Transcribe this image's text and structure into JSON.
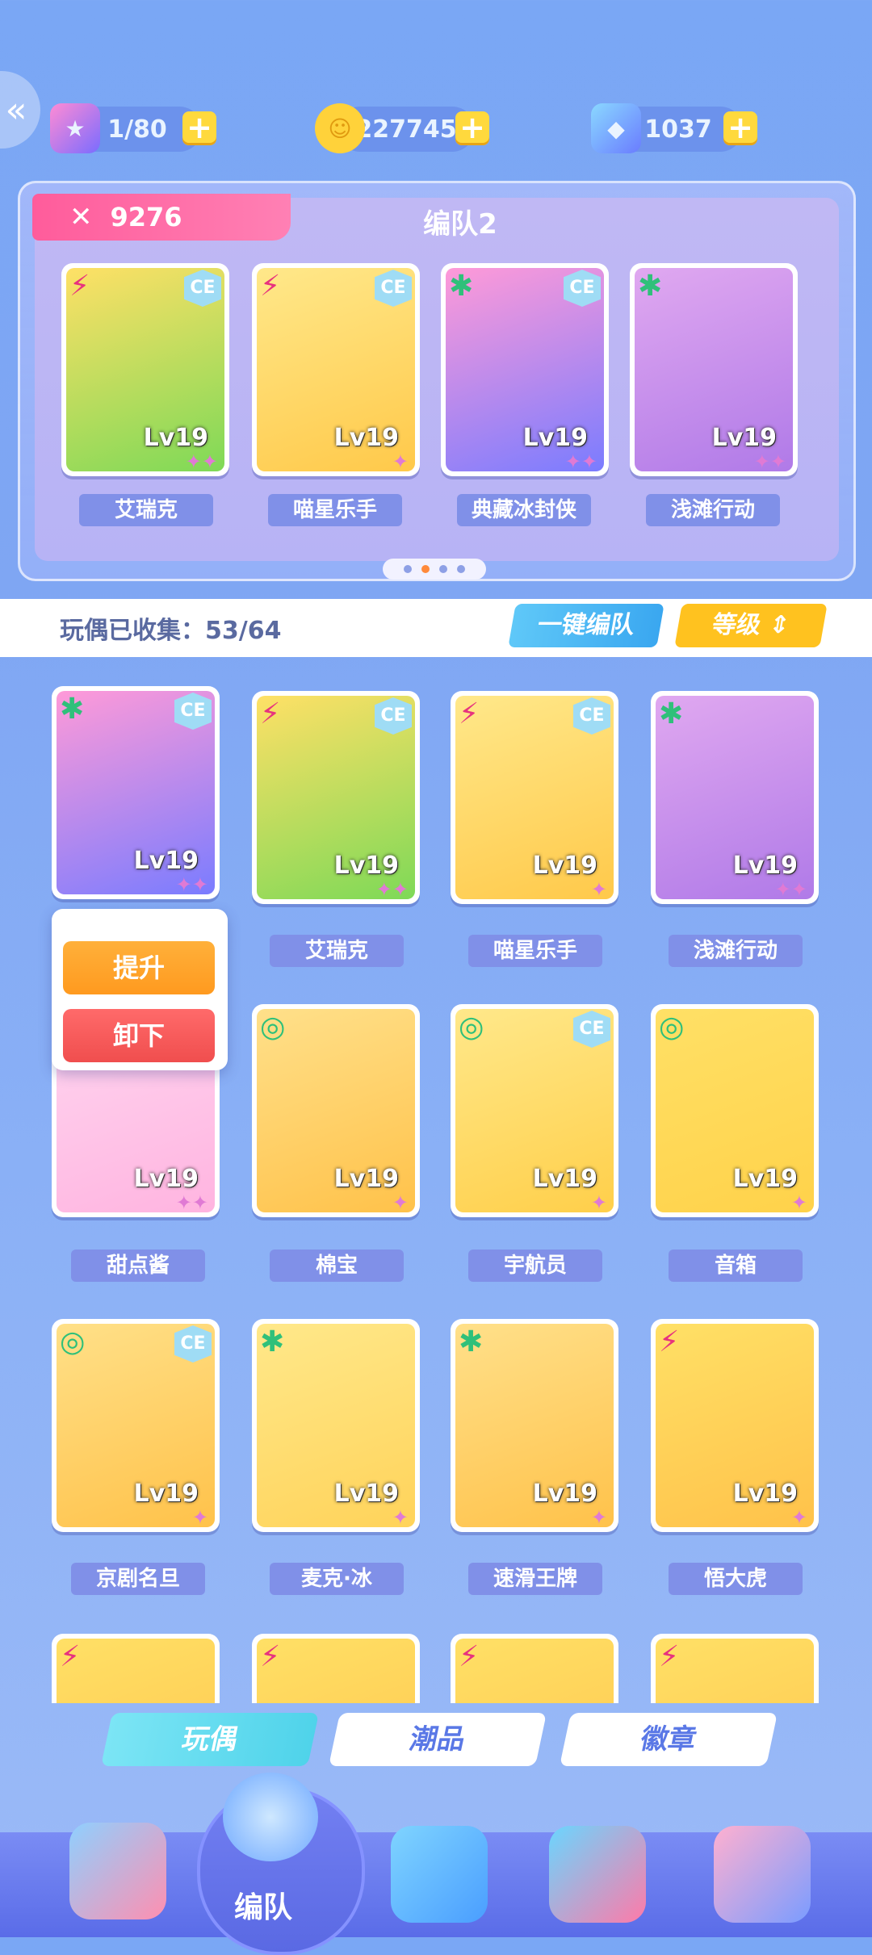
{
  "resources": [
    {
      "name": "energy",
      "icon": "ticket-icon",
      "value": "1/80"
    },
    {
      "name": "coins",
      "icon": "coin-icon",
      "value": "227745"
    },
    {
      "name": "gems",
      "icon": "crystal-icon",
      "value": "1037"
    }
  ],
  "team": {
    "power": "9276",
    "name": "编队2",
    "members": [
      {
        "name": "艾瑞克",
        "level": "Lv19",
        "element": "⚡",
        "ce": true
      },
      {
        "name": "喵星乐手",
        "level": "Lv19",
        "element": "⚡",
        "ce": true
      },
      {
        "name": "典藏冰封侠",
        "level": "Lv19",
        "element": "✱",
        "ce": true
      },
      {
        "name": "浅滩行动",
        "level": "Lv19",
        "element": "✱",
        "ce": false
      }
    ]
  },
  "collection": {
    "label": "玩偶已收集：53/64",
    "auto_button": "一键编队",
    "sort_button": "等级"
  },
  "cards": [
    {
      "name": "",
      "level": "Lv19",
      "element": "✱",
      "ce": true
    },
    {
      "name": "艾瑞克",
      "level": "Lv19",
      "element": "⚡",
      "ce": true
    },
    {
      "name": "喵星乐手",
      "level": "Lv19",
      "element": "⚡",
      "ce": true
    },
    {
      "name": "浅滩行动",
      "level": "Lv19",
      "element": "✱",
      "ce": false
    },
    {
      "name": "甜点酱",
      "level": "Lv19",
      "element": "",
      "ce": false
    },
    {
      "name": "棉宝",
      "level": "Lv19",
      "element": "◎",
      "ce": false
    },
    {
      "name": "宇航员",
      "level": "Lv19",
      "element": "◎",
      "ce": true
    },
    {
      "name": "音箱",
      "level": "Lv19",
      "element": "◎",
      "ce": false
    },
    {
      "name": "京剧名旦",
      "level": "Lv19",
      "element": "◎",
      "ce": true
    },
    {
      "name": "麦克·冰",
      "level": "Lv19",
      "element": "✱",
      "ce": false
    },
    {
      "name": "速滑王牌",
      "level": "Lv19",
      "element": "✱",
      "ce": false
    },
    {
      "name": "悟大虎",
      "level": "Lv19",
      "element": "⚡",
      "ce": false
    }
  ],
  "popup": {
    "upgrade": "提升",
    "unload": "卸下"
  },
  "tabs": [
    {
      "label": "玩偶",
      "active": true
    },
    {
      "label": "潮品",
      "active": false
    },
    {
      "label": "徽章",
      "active": false
    }
  ],
  "nav": {
    "center_label": "编队"
  }
}
